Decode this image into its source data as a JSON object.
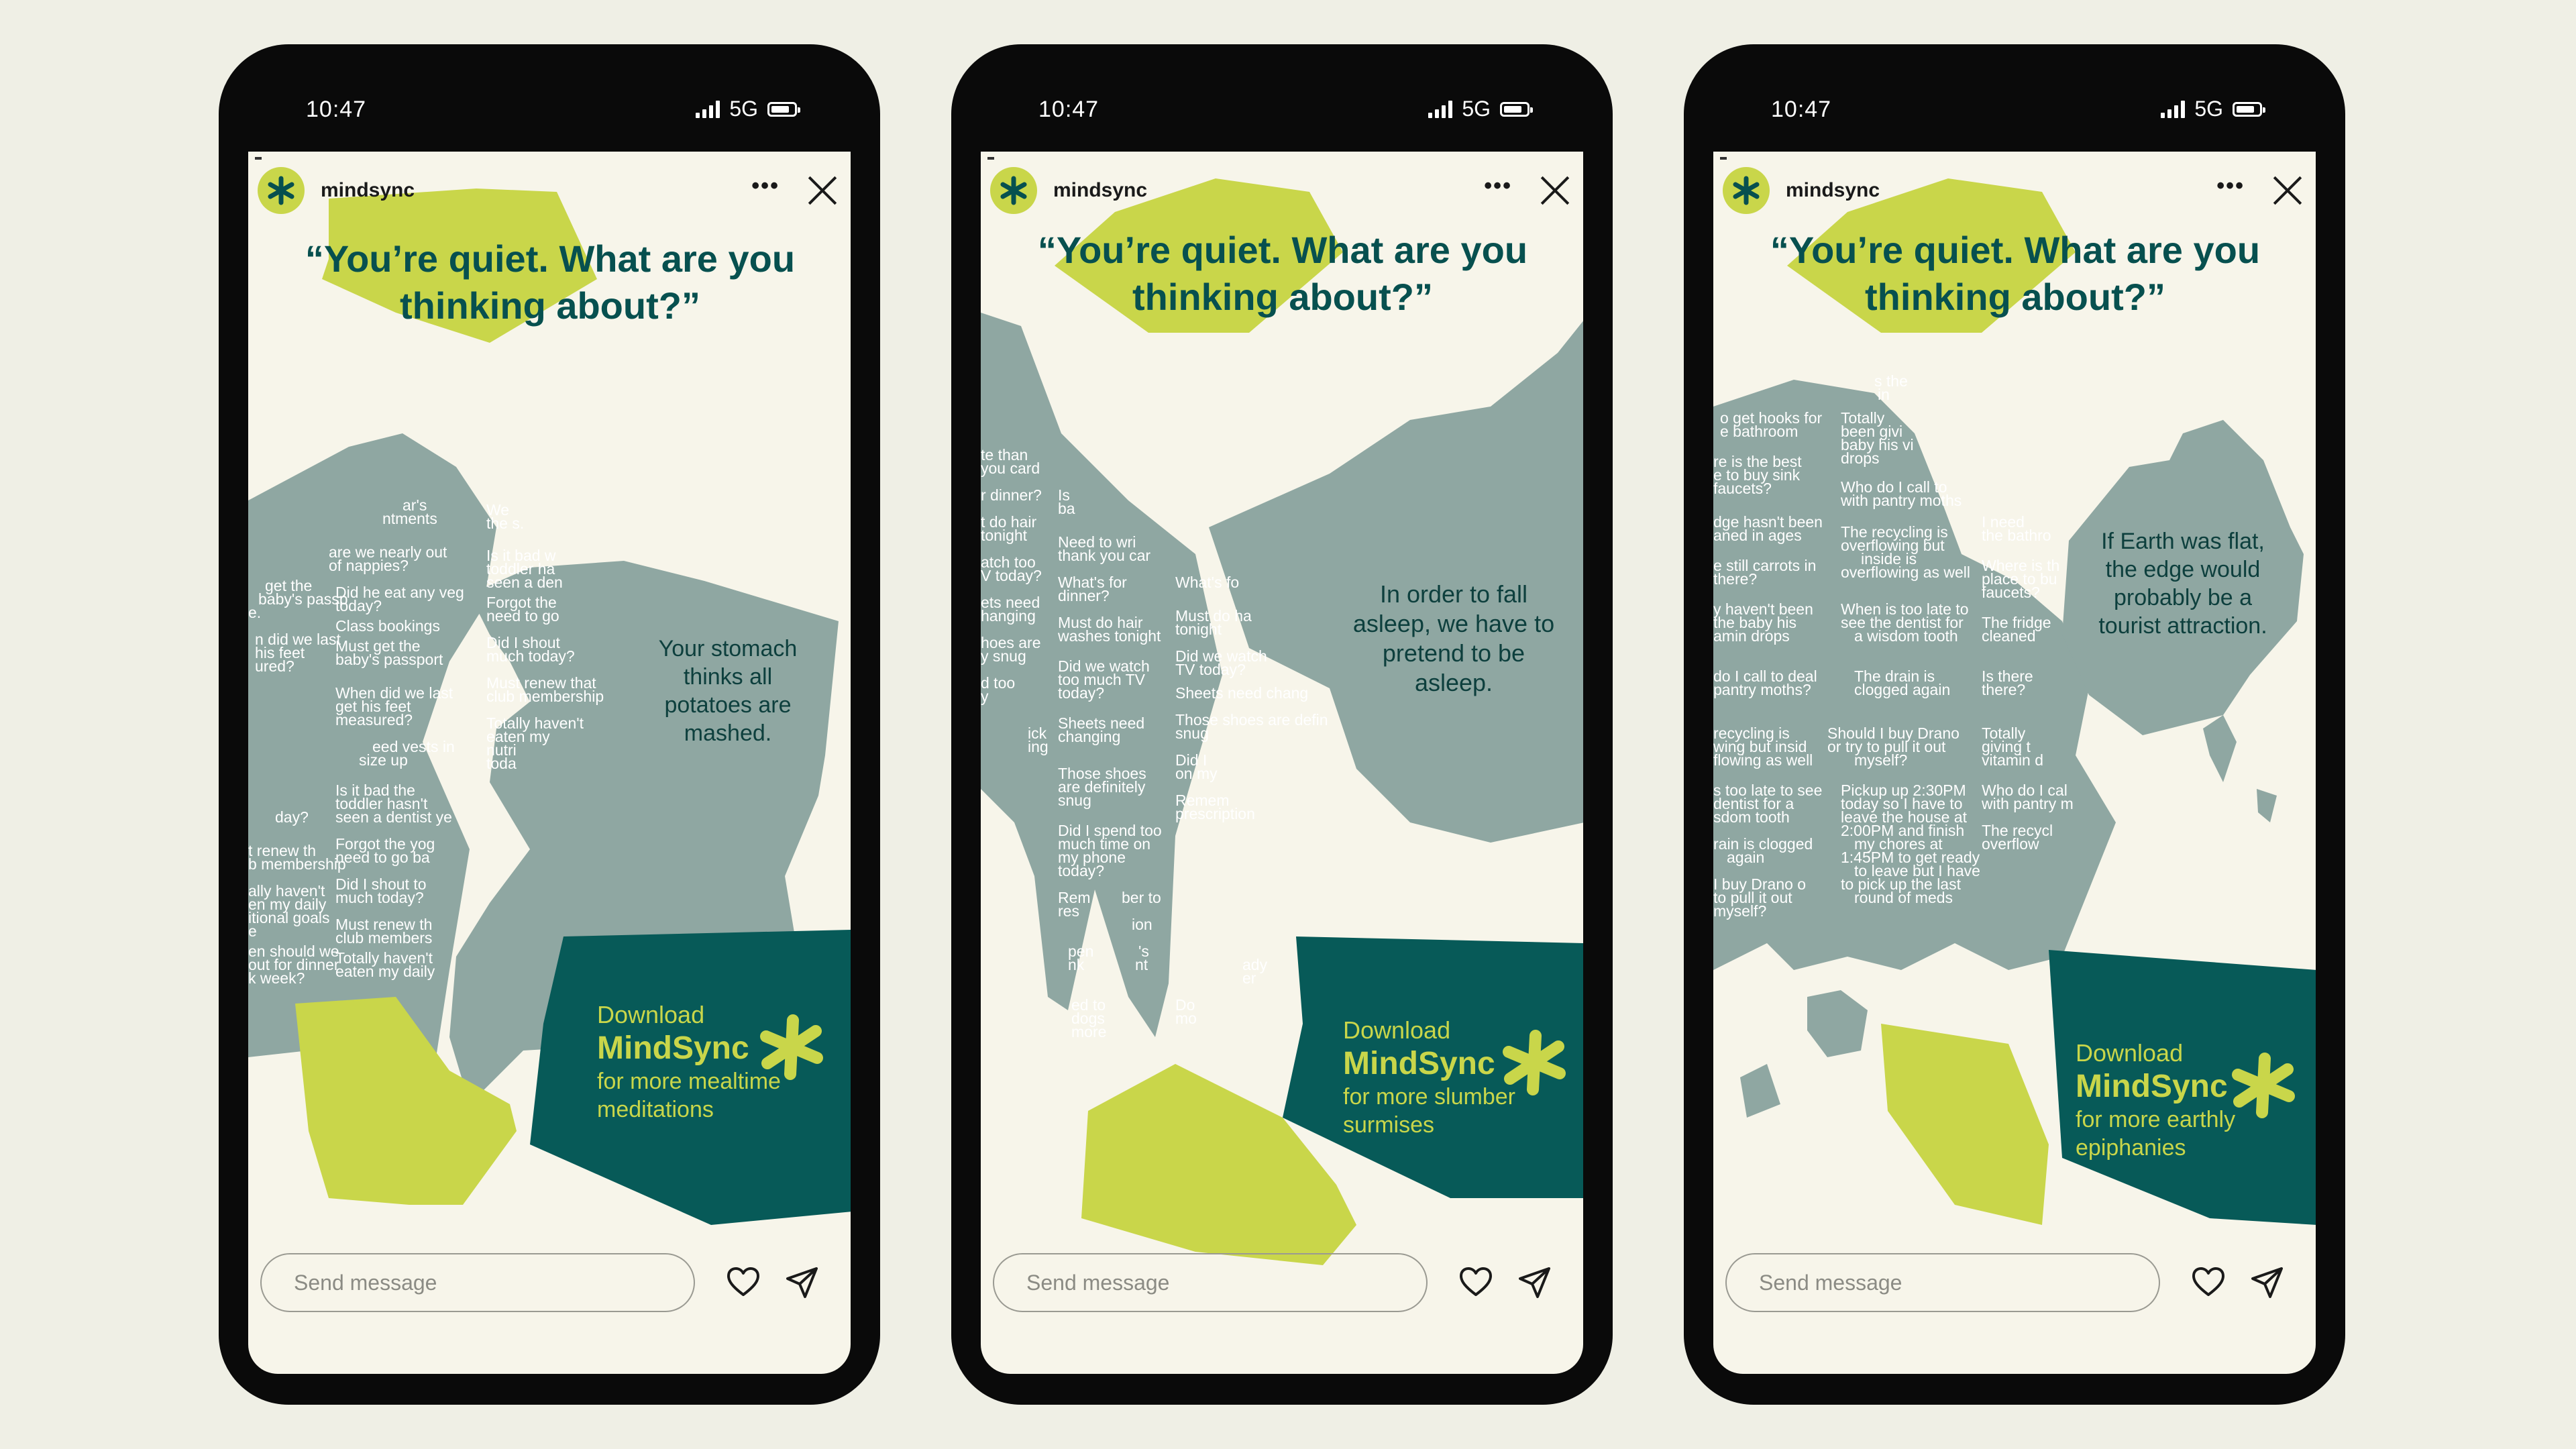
{
  "status": {
    "time": "10:47",
    "network": "5G"
  },
  "story": {
    "username": "mindsync",
    "more_label": "•••",
    "message_placeholder": "Send message"
  },
  "cards": [
    {
      "headline": "“You’re quiet. What are you thinking about?”",
      "thought": "Your stomach thinks all potatoes are mashed.",
      "cta": {
        "download": "Download",
        "brand": "MindSync",
        "tagline": "for more mealtime meditations"
      }
    },
    {
      "headline": "“You’re quiet. What are you thinking about?”",
      "thought": "In order to fall asleep, we have to pretend to be asleep.",
      "cta": {
        "download": "Download",
        "brand": "MindSync",
        "tagline": "for more slumber surmises"
      }
    },
    {
      "headline": "“You’re quiet. What are you thinking about?”",
      "thought": "If Earth was flat, the edge would probably be a tourist attraction.",
      "cta": {
        "download": "Download",
        "brand": "MindSync",
        "tagline": "for more earthly epiphanies"
      }
    }
  ],
  "colors": {
    "lime": "#c9d64a",
    "teal": "#075a58",
    "sage": "#8fa7a2",
    "ink": "#07504f",
    "paper": "#f7f5ea"
  },
  "icons": [
    "asterisk-logo-icon",
    "more-icon",
    "close-icon",
    "heart-icon",
    "send-icon",
    "signal-icon",
    "battery-icon"
  ]
}
